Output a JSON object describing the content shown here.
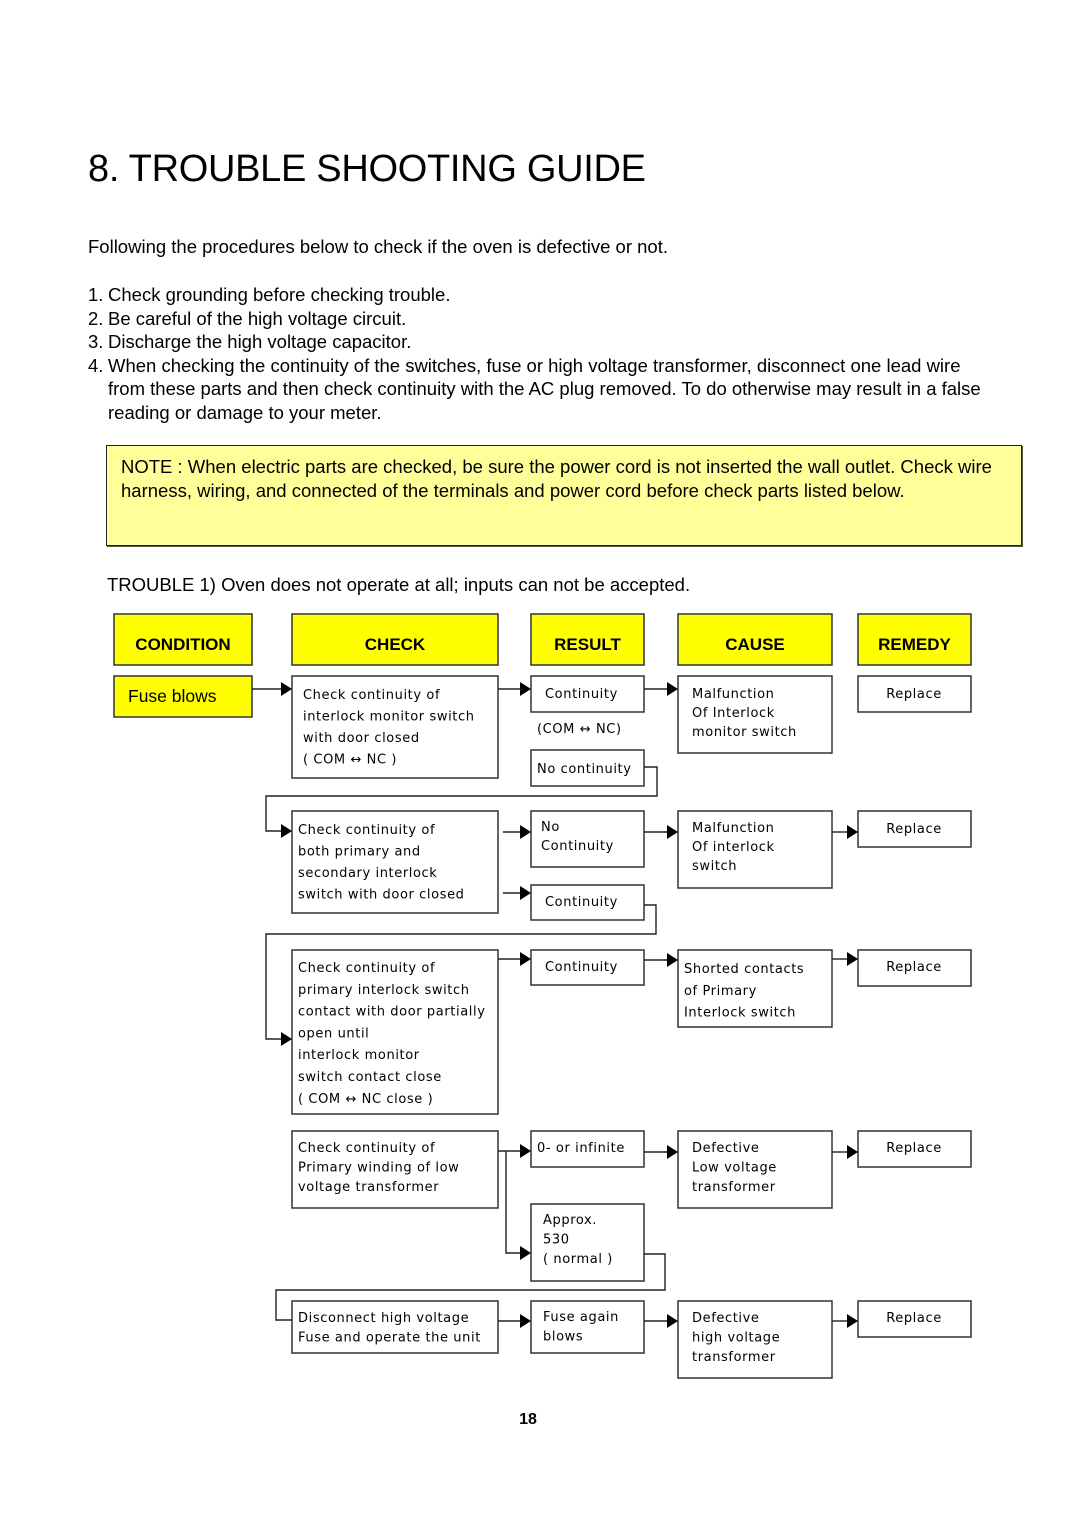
{
  "document": {
    "title": "8. TROUBLE SHOOTING GUIDE",
    "intro": "Following the procedures below to check if the oven is defective or not.",
    "steps": [
      {
        "num": "1.",
        "text": "Check grounding before checking trouble."
      },
      {
        "num": "2.",
        "text": "Be careful of the high voltage circuit."
      },
      {
        "num": "3.",
        "text": "Discharge the high voltage capacitor."
      },
      {
        "num": "4.",
        "text": "When checking the continuity of the switches, fuse or high voltage transformer, disconnect one lead wire from these parts and then check continuity with the AC plug removed. To do otherwise may result in a false reading or damage to your meter."
      }
    ],
    "note": "NOTE : When electric parts are checked, be sure the power cord is not inserted the wall outlet. Check wire harness, wiring, and connected of the terminals and power cord before check parts listed below.",
    "trouble_heading": "TROUBLE  1) Oven does not operate at all; inputs can not be accepted.",
    "page_number": "18",
    "colors": {
      "header_fill": "#ffff00",
      "note_fill": "#ffff99"
    }
  },
  "flowchart": {
    "headers": {
      "condition": "CONDITION",
      "check": "CHECK",
      "result": "RESULT",
      "cause": "CAUSE",
      "remedy": "REMEDY"
    },
    "condition": "Fuse blows",
    "step1": {
      "check": [
        "Check continuity of",
        "interlock monitor switch",
        "with door closed",
        "( COM ↔ NC )"
      ],
      "result_a": [
        "Continuity"
      ],
      "result_a_note": "(COM ↔ NC)",
      "result_b": [
        "No continuity"
      ],
      "cause": [
        "Malfunction",
        "Of Interlock",
        "monitor switch"
      ],
      "remedy": "Replace"
    },
    "step2": {
      "check": [
        "Check continuity of",
        "both primary and",
        "secondary interlock",
        "switch with door closed"
      ],
      "result_a": [
        "No",
        "Continuity"
      ],
      "result_b": [
        "Continuity"
      ],
      "cause": [
        "Malfunction",
        "Of interlock",
        "switch"
      ],
      "remedy": "Replace"
    },
    "step3": {
      "check": [
        "Check continuity of",
        "primary interlock switch",
        "contact with door partially",
        "open until",
        "interlock monitor",
        "switch contact close",
        "( COM ↔ NC close )"
      ],
      "result_a": [
        "Continuity"
      ],
      "cause": [
        "Shorted contacts",
        "of   Primary",
        "Interlock switch"
      ],
      "remedy": "Replace"
    },
    "step4": {
      "check": [
        "Check continuity of",
        "Primary winding of low",
        "voltage transformer"
      ],
      "result_a": [
        "0- or infinite"
      ],
      "result_b": [
        "Approx.",
        "530",
        "( normal )"
      ],
      "cause": [
        "Defective",
        "Low voltage",
        "transformer"
      ],
      "remedy": "Replace"
    },
    "step5": {
      "check": [
        "Disconnect high voltage",
        "Fuse and operate the unit"
      ],
      "result_a": [
        "Fuse again",
        "blows"
      ],
      "cause": [
        "Defective",
        "high voltage",
        "transformer"
      ],
      "remedy": "Replace"
    }
  }
}
